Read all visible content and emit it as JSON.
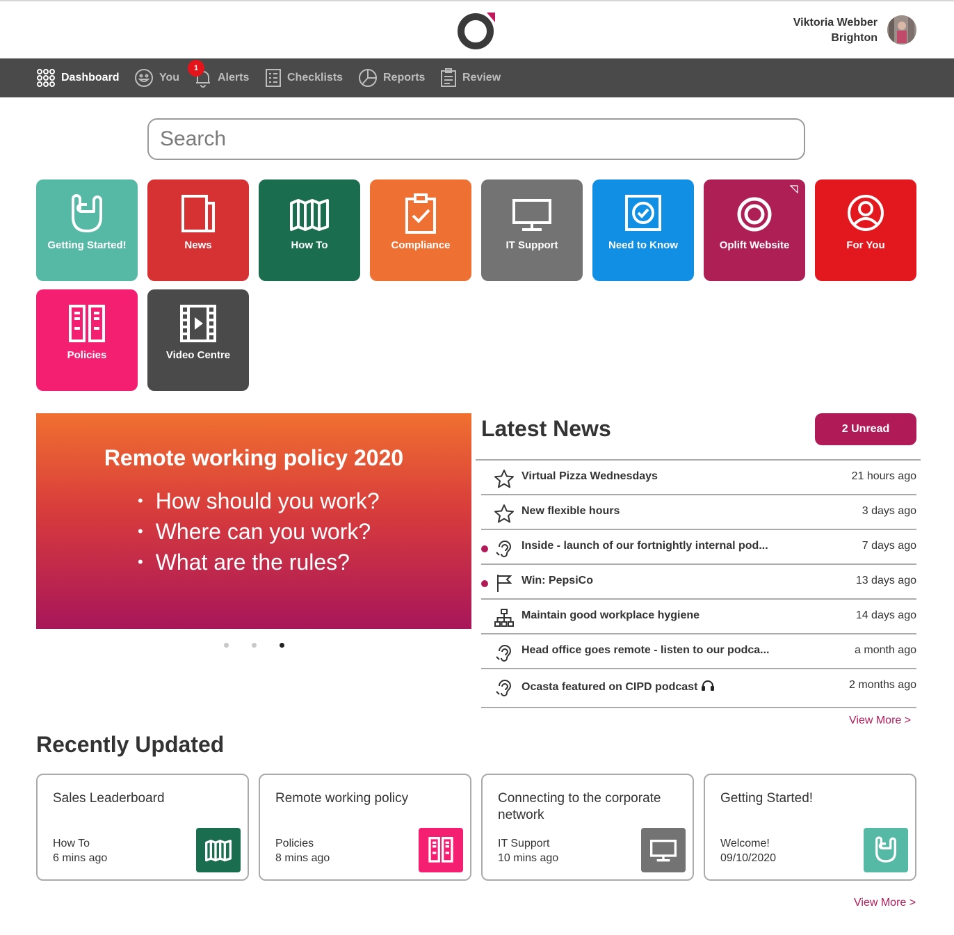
{
  "header": {
    "user_name": "Viktoria Webber",
    "user_location": "Brighton"
  },
  "nav": {
    "items": [
      {
        "label": "Dashboard",
        "icon": "grid-icon",
        "active": true
      },
      {
        "label": "You",
        "icon": "smiley-icon"
      },
      {
        "label": "Alerts",
        "icon": "bell-icon",
        "badge": "1"
      },
      {
        "label": "Checklists",
        "icon": "checklist-icon"
      },
      {
        "label": "Reports",
        "icon": "pie-chart-icon"
      },
      {
        "label": "Review",
        "icon": "clipboard-icon"
      }
    ]
  },
  "search": {
    "placeholder": "Search"
  },
  "tiles": [
    {
      "label": "Getting Started!",
      "color": "#56b9a5",
      "icon": "rock-hand-icon"
    },
    {
      "label": "News",
      "color": "#d63234",
      "icon": "newspaper-icon"
    },
    {
      "label": "How To",
      "color": "#1a6d4f",
      "icon": "map-icon"
    },
    {
      "label": "Compliance",
      "color": "#ee7032",
      "icon": "clipboard-check-icon"
    },
    {
      "label": "IT Support",
      "color": "#737373",
      "icon": "monitor-icon"
    },
    {
      "label": "Need to Know",
      "color": "#118fe4",
      "icon": "check-badge-icon"
    },
    {
      "label": "Oplift Website",
      "color": "#ad1f55",
      "icon": "oplift-logo-icon"
    },
    {
      "label": "For You",
      "color": "#e3171e",
      "icon": "user-circle-icon"
    },
    {
      "label": "Policies",
      "color": "#f51f72",
      "icon": "binders-icon"
    },
    {
      "label": "Video Centre",
      "color": "#4a4a4a",
      "icon": "film-icon"
    }
  ],
  "banner": {
    "title": "Remote working policy 2020",
    "bullets": [
      "How should you work?",
      "Where can you work?",
      "What are the rules?"
    ],
    "active_slide": 3,
    "slide_count": 3
  },
  "news": {
    "title": "Latest News",
    "unread_label": "2 Unread",
    "items": [
      {
        "title": "Virtual Pizza Wednesdays",
        "time": "21 hours ago",
        "icon": "star-icon",
        "unread": false
      },
      {
        "title": "New flexible hours",
        "time": "3 days ago",
        "icon": "star-icon",
        "unread": false
      },
      {
        "title": "Inside - launch of our fortnightly internal pod...",
        "time": "7 days ago",
        "icon": "ear-icon",
        "unread": true
      },
      {
        "title": "Win: PepsiCo",
        "time": "13 days ago",
        "icon": "flag-icon",
        "unread": true
      },
      {
        "title": "Maintain good workplace hygiene",
        "time": "14 days ago",
        "icon": "org-chart-icon",
        "unread": false
      },
      {
        "title": "Head office goes remote - listen to our podca...",
        "time": "a month ago",
        "icon": "ear-icon",
        "unread": false
      },
      {
        "title": "Ocasta featured on CIPD podcast",
        "time": "2 months ago",
        "icon": "ear-icon",
        "unread": false,
        "extra_icon": "headphones-icon"
      }
    ],
    "view_more": "View More >"
  },
  "recent": {
    "title": "Recently Updated",
    "cards": [
      {
        "title": "Sales Leaderboard",
        "section": "How To",
        "time": "6 mins ago",
        "color": "#1a6d4f",
        "icon": "map-icon"
      },
      {
        "title": "Remote working policy",
        "section": "Policies",
        "time": "8 mins ago",
        "color": "#f51f72",
        "icon": "binders-icon"
      },
      {
        "title": "Connecting to the corporate network",
        "section": "IT Support",
        "time": "10 mins ago",
        "color": "#737373",
        "icon": "monitor-icon"
      },
      {
        "title": "Getting Started!",
        "section": "Welcome!",
        "time": "09/10/2020",
        "color": "#56b9a5",
        "icon": "rock-hand-icon"
      }
    ],
    "view_more": "View More >"
  }
}
